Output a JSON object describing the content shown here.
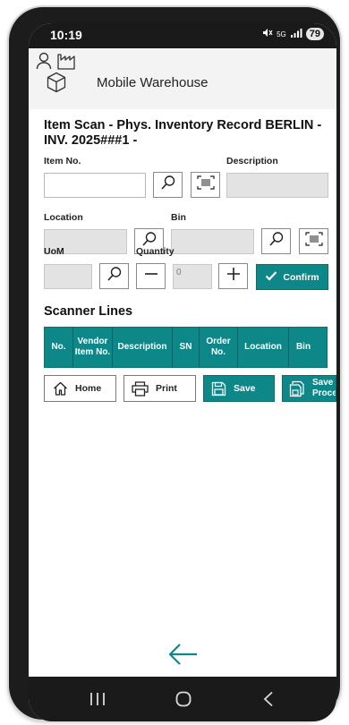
{
  "status_bar": {
    "time": "10:19",
    "network": "5G",
    "battery": "79"
  },
  "header": {
    "title": "Mobile Warehouse",
    "icons": [
      "user-icon",
      "factory-icon",
      "box-icon"
    ]
  },
  "page": {
    "title": "Item Scan - Phys. Inventory Record BERLIN - INV. 2025###1 -"
  },
  "form": {
    "item_no": {
      "label": "Item No.",
      "value": ""
    },
    "description": {
      "label": "Description",
      "value": ""
    },
    "location": {
      "label": "Location",
      "value": ""
    },
    "bin": {
      "label": "Bin",
      "value": ""
    },
    "uom": {
      "label": "UoM",
      "value": ""
    },
    "quantity": {
      "label": "Quantity",
      "value": "0"
    },
    "confirm_label": "Confirm"
  },
  "scanner_lines": {
    "title": "Scanner Lines",
    "columns": [
      "No.",
      "Vendor Item No.",
      "Description",
      "SN",
      "Order No.",
      "Location",
      "Bin"
    ]
  },
  "actions": {
    "home": "Home",
    "print": "Print",
    "save": "Save",
    "save_process": "Save & Process"
  },
  "colors": {
    "accent": "#0e8789",
    "header_bg": "#f3f3f3",
    "disabled_bg": "#e3e3e3"
  }
}
